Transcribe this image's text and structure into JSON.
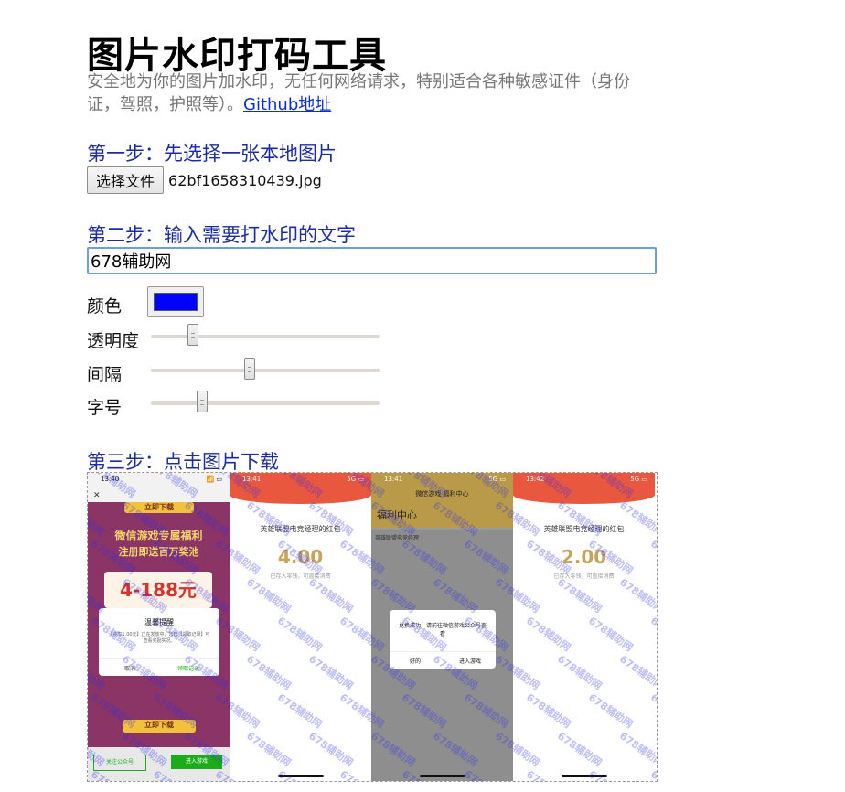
{
  "header": {
    "title": "图片水印打码工具",
    "description": "安全地为你的图片加水印，无任何网络请求，特别适合各种敏感证件（身份证，驾照，护照等）。",
    "github_link": "Github地址"
  },
  "step1": {
    "label": "第一步：先选择一张本地图片",
    "button": "选择文件",
    "file_name": "62bf1658310439.jpg"
  },
  "step2": {
    "label": "第二步：输入需要打水印的文字",
    "text_value": "678辅助网",
    "color_label": "颜色",
    "color_value": "#0000ff",
    "opacity_label": "透明度",
    "opacity_value": 0.17,
    "spacing_label": "间隔",
    "spacing_value": 0.43,
    "fontsize_label": "字号",
    "fontsize_value": 0.21
  },
  "step3": {
    "label": "第三步：点击图片下载",
    "watermark_text": "678辅助网",
    "screens": [
      {
        "time": "13:40",
        "banner_top": "立即下载",
        "promo_line1": "微信游戏专属福利",
        "promo_line2": "注册即送百万奖池",
        "promo_amount": "4-188元",
        "dialog_title": "温馨提醒",
        "dialog_body": "【共享1.00元】正在发放中，您已【领取记录】可查看奖励实况。",
        "dialog_left": "取消",
        "dialog_right": "领取记录",
        "banner_bottom": "立即下载",
        "btn_left": "关注公众号",
        "btn_right": "进入游戏"
      },
      {
        "time": "13:41",
        "gift_title": "英雄联盟电竞经理的红包",
        "amount": "4.00",
        "note": "已存入零钱，可直接消费"
      },
      {
        "time": "13:41",
        "nav_title": "微信游戏 福利中心",
        "page_title": "福利中心",
        "tab": "英雄联盟电竞经理",
        "dialog_body": "兑换成功，请前往微信游戏公众号查看",
        "dialog_left": "好的",
        "dialog_right": "进入游戏"
      },
      {
        "time": "13:42",
        "gift_title": "英雄联盟电竞经理的红包",
        "amount": "2.00",
        "note": "已存入零钱，可直接消费"
      }
    ]
  }
}
